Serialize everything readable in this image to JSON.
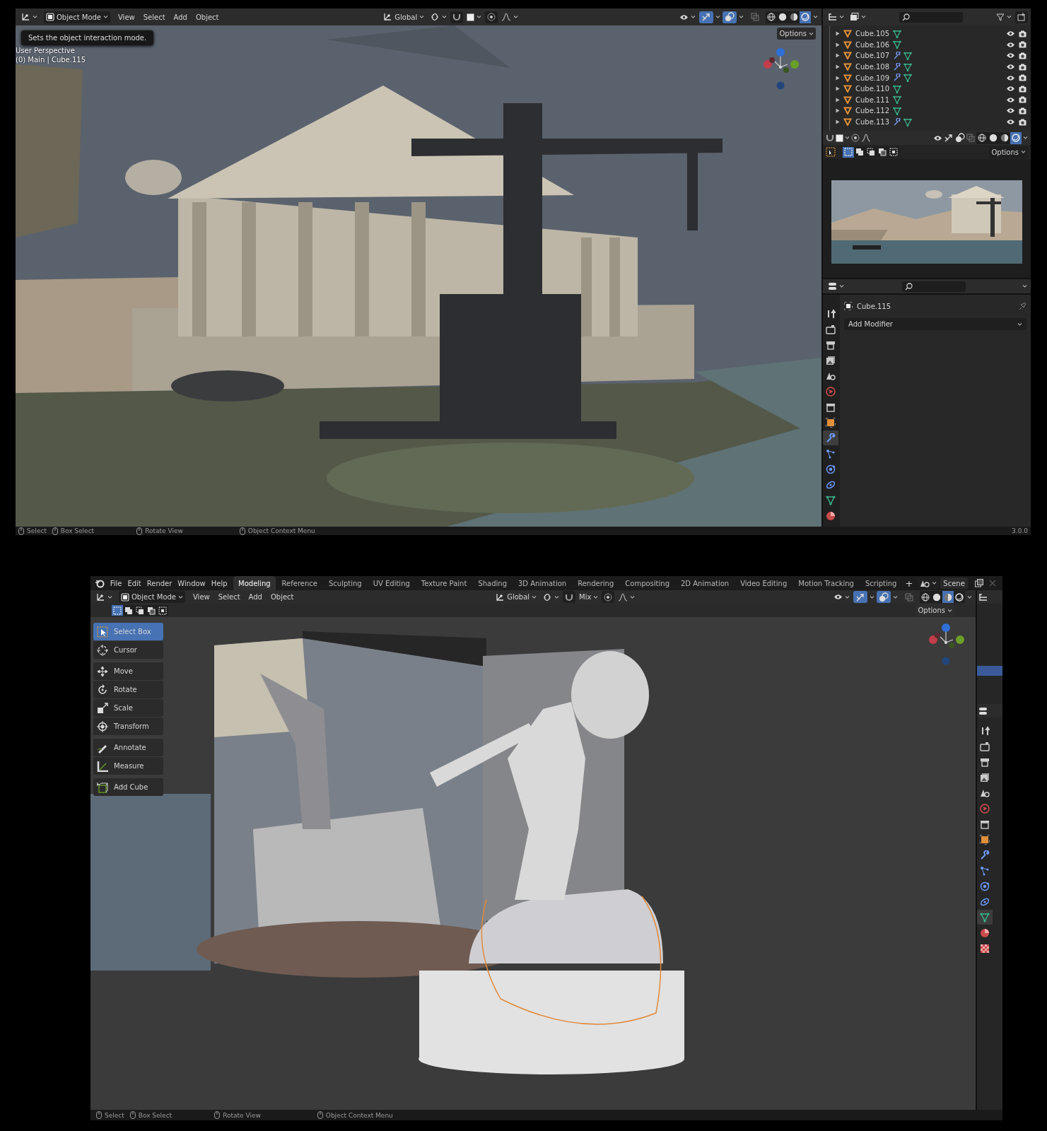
{
  "top": {
    "header": {
      "mode": "Object Mode",
      "menus": [
        "View",
        "Select",
        "Add",
        "Object"
      ],
      "orientation": "Global",
      "gizmos_on": true,
      "overlays_on": true,
      "shading": [
        {
          "kind": "wireframe",
          "selected": false
        },
        {
          "kind": "solid",
          "selected": false
        },
        {
          "kind": "material",
          "selected": false
        },
        {
          "kind": "rendered",
          "selected": true
        }
      ]
    },
    "viewport": {
      "tooltip": "Sets the object interaction mode.",
      "info": [
        "User Perspective",
        "(0) Main | Cube.115"
      ],
      "options": "Options"
    },
    "outliner": {
      "rows": [
        {
          "name": "Cube.105",
          "modifier": false
        },
        {
          "name": "Cube.106",
          "modifier": false
        },
        {
          "name": "Cube.107",
          "modifier": true
        },
        {
          "name": "Cube.108",
          "modifier": true
        },
        {
          "name": "Cube.109",
          "modifier": true
        },
        {
          "name": "Cube.110",
          "modifier": false
        },
        {
          "name": "Cube.111",
          "modifier": false
        },
        {
          "name": "Cube.112",
          "modifier": false
        },
        {
          "name": "Cube.113",
          "modifier": true
        }
      ]
    },
    "mini_viewport": {
      "shading": [
        {
          "kind": "wireframe",
          "selected": false
        },
        {
          "kind": "solid",
          "selected": false
        },
        {
          "kind": "material",
          "selected": false
        },
        {
          "kind": "rendered",
          "selected": true
        }
      ],
      "select_modes": [
        {
          "selected": true
        },
        {
          "selected": false
        },
        {
          "selected": false
        },
        {
          "selected": false
        },
        {
          "selected": false
        }
      ],
      "options": "Options"
    },
    "properties": {
      "object": "Cube.115",
      "add_modifier": "Add Modifier",
      "tabs": [
        {
          "kind": "tool",
          "selected": false
        },
        {
          "kind": "render",
          "selected": false
        },
        {
          "kind": "output",
          "selected": false
        },
        {
          "kind": "view_layer",
          "selected": false
        },
        {
          "kind": "scene",
          "selected": false
        },
        {
          "kind": "world",
          "selected": false
        },
        {
          "kind": "collection",
          "selected": false
        },
        {
          "kind": "object",
          "selected": false
        },
        {
          "kind": "modifier",
          "selected": true
        },
        {
          "kind": "particles",
          "selected": false
        },
        {
          "kind": "physics",
          "selected": false
        },
        {
          "kind": "constraints",
          "selected": false
        },
        {
          "kind": "data",
          "selected": false
        },
        {
          "kind": "material",
          "selected": false
        }
      ]
    },
    "status_bar": {
      "items": [
        "Select",
        "Box Select",
        "Rotate View",
        "Object Context Menu"
      ],
      "version": "3.0.0"
    }
  },
  "bottom": {
    "menus": [
      "File",
      "Edit",
      "Render",
      "Window",
      "Help"
    ],
    "workspaces": [
      {
        "label": "Modeling",
        "selected": true
      },
      {
        "label": "Reference",
        "selected": false
      },
      {
        "label": "Sculpting",
        "selected": false
      },
      {
        "label": "UV Editing",
        "selected": false
      },
      {
        "label": "Texture Paint",
        "selected": false
      },
      {
        "label": "Shading",
        "selected": false
      },
      {
        "label": "3D Animation",
        "selected": false
      },
      {
        "label": "Rendering",
        "selected": false
      },
      {
        "label": "Compositing",
        "selected": false
      },
      {
        "label": "2D Animation",
        "selected": false
      },
      {
        "label": "Video Editing",
        "selected": false
      },
      {
        "label": "Motion Tracking",
        "selected": false
      },
      {
        "label": "Scripting",
        "selected": false
      }
    ],
    "add_workspace": "+",
    "scene": "Scene",
    "header": {
      "mode": "Object Mode",
      "menus": [
        "View",
        "Select",
        "Add",
        "Object"
      ],
      "orientation": "Global",
      "snap_target": "Mix",
      "gizmos_on": true,
      "overlays_on": true,
      "shading": [
        {
          "kind": "wireframe",
          "selected": false
        },
        {
          "kind": "solid",
          "selected": false
        },
        {
          "kind": "material",
          "selected": true
        },
        {
          "kind": "rendered",
          "selected": false
        }
      ]
    },
    "select_modes": [
      {
        "selected": true
      },
      {
        "selected": false
      },
      {
        "selected": false
      },
      {
        "selected": false
      },
      {
        "selected": false
      }
    ],
    "options": "Options",
    "tool_groups": [
      [
        {
          "kind": "select",
          "label": "Select Box",
          "selected": true
        },
        {
          "kind": "cursor",
          "label": "Cursor",
          "selected": false
        }
      ],
      [
        {
          "kind": "move",
          "label": "Move",
          "selected": false
        },
        {
          "kind": "rotate",
          "label": "Rotate",
          "selected": false
        },
        {
          "kind": "scale",
          "label": "Scale",
          "selected": false
        },
        {
          "kind": "transform",
          "label": "Transform",
          "selected": false
        }
      ],
      [
        {
          "kind": "annotate",
          "label": "Annotate",
          "selected": false
        },
        {
          "kind": "measure",
          "label": "Measure",
          "selected": false
        }
      ],
      [
        {
          "kind": "add_cube",
          "label": "Add Cube",
          "selected": false
        }
      ]
    ],
    "properties_tabs": [
      {
        "kind": "tool",
        "selected": false
      },
      {
        "kind": "render",
        "selected": false
      },
      {
        "kind": "output",
        "selected": false
      },
      {
        "kind": "view_layer",
        "selected": false
      },
      {
        "kind": "scene",
        "selected": false
      },
      {
        "kind": "world",
        "selected": false
      },
      {
        "kind": "collection",
        "selected": false
      },
      {
        "kind": "object",
        "selected": false
      },
      {
        "kind": "modifier",
        "selected": false
      },
      {
        "kind": "particles",
        "selected": false
      },
      {
        "kind": "physics",
        "selected": false
      },
      {
        "kind": "constraints",
        "selected": false
      },
      {
        "kind": "data",
        "selected": true
      },
      {
        "kind": "material",
        "selected": false
      },
      {
        "kind": "texture",
        "selected": false
      }
    ],
    "status_bar": {
      "items": [
        "Select",
        "Box Select",
        "Rotate View",
        "Object Context Menu"
      ]
    }
  }
}
